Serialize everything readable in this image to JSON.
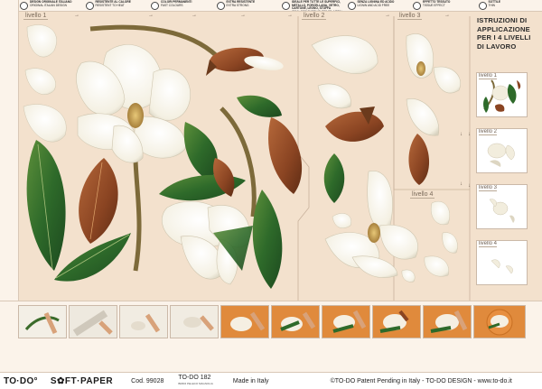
{
  "features": [
    {
      "title": "DESIGN ORIGINALE ITALIANO",
      "sub": "ORIGINAL ITALIAN DESIGN"
    },
    {
      "title": "RESISTENTE AL CALORE",
      "sub": "RESISTENT TO HEAT"
    },
    {
      "title": "COLORI PERMANENTI",
      "sub": "FAST COLOURS"
    },
    {
      "title": "EXTRA RESISTENTE",
      "sub": "EXTRA STRONG"
    },
    {
      "title": "IDEALE PER TUTTE LE SUPERFICI, METALLO, PORCELLANA, VETRO, CARTONE, LEGNO, STOFFA",
      "sub": "IDEAL FOR EVERY SURFACE, METAL, PORCELAIN, GLASS, CARDBOARD, WOOD, FABRIC"
    },
    {
      "title": "SENZA LIGNINA ED ACIDO",
      "sub": "LIGNIN AND ACID FREE"
    },
    {
      "title": "EFFETTO TESSUTO",
      "sub": "TISSUE EFFECT"
    },
    {
      "title": "SOTTILE",
      "sub": "THIN"
    }
  ],
  "levels": {
    "l1": "livello 1",
    "l2": "livello 2",
    "l3": "livello 3",
    "l4": "livello 4"
  },
  "instructions": {
    "title": "ISTRUZIONI DI APPLICAZIONE PER I 4 LIVELLI DI LAVORO"
  },
  "thumbs": [
    "livello 1",
    "livello 2",
    "livello 3",
    "livello 4"
  ],
  "footer": {
    "brand": "TO·DO°",
    "brand2": "S✿FT·PAPER",
    "code": "Cod. 99028",
    "code2": "TO-DO 182",
    "code2_sub": "BR6DI PELECO MAGNOLIA",
    "made": "Made in Italy",
    "patent": "©TO-DO Patent Pending in Italy - TO-DO DESIGN - www.to-do.it"
  },
  "colors": {
    "background": "#f3e1cd",
    "leaf_green": "#2f6b2a",
    "leaf_brown": "#8a4a25",
    "petal": "#fbf8ef",
    "orange_plate": "#e08a3c"
  }
}
